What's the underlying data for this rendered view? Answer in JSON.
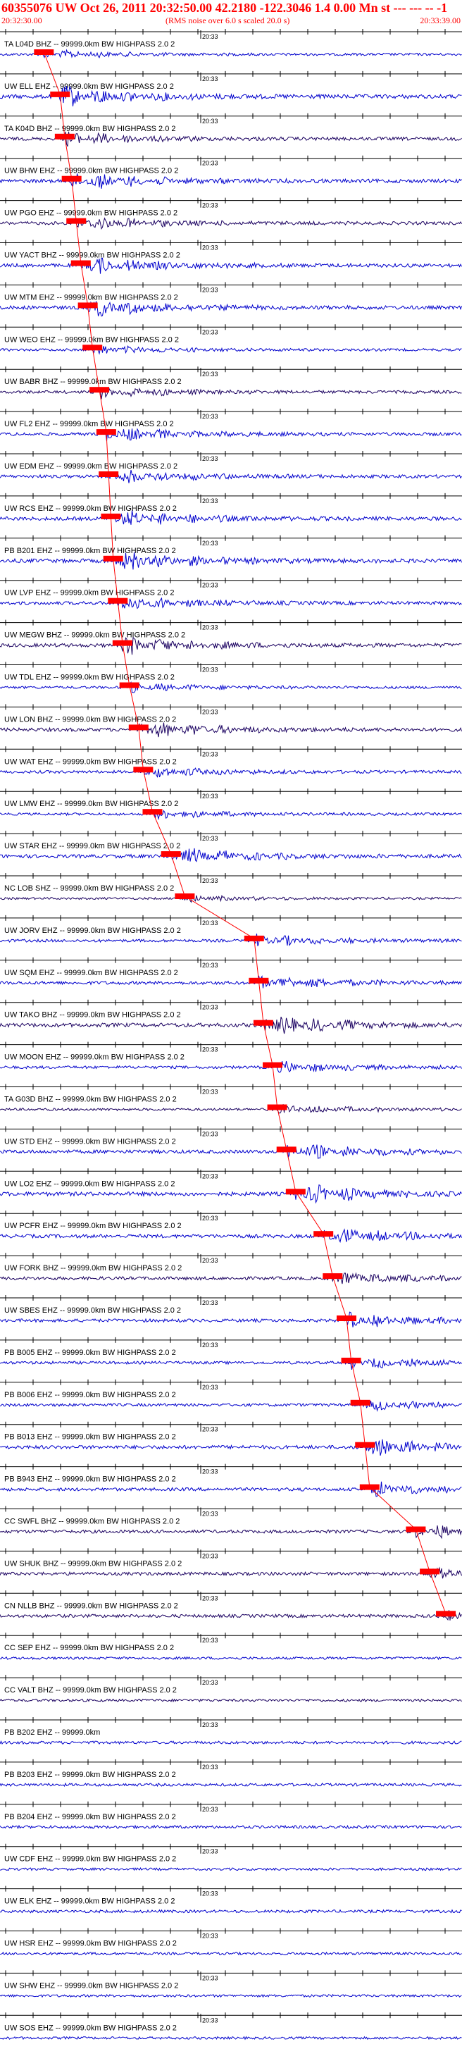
{
  "header": {
    "title": "60355076 UW Oct 26, 2011 20:32:50.00   42.2180 -122.3046  1.4 0.00 Mn st --- --- -- -1",
    "start_time": "20:32:30.00",
    "note": "(RMS noise over 6.0 s scaled 20.0 s)",
    "end_time": "20:33:39.00"
  },
  "minute_label": "20:33",
  "colors": {
    "trace_a": "#0000cc",
    "trace_b": "#1a0060",
    "pick": "#ff0000",
    "axis": "#000000"
  },
  "traces": [
    {
      "label": "TA L04D BHZ -- 99999.0km BW  HIGHPASS  2.0  2",
      "pick": 0.095,
      "amp": 0.3,
      "color": "trace_a"
    },
    {
      "label": "UW ELL EHZ -- 99999.0km BW  HIGHPASS  2.0  2",
      "pick": 0.13,
      "amp": 0.7,
      "color": "trace_a"
    },
    {
      "label": "TA K04D BHZ -- 99999.0km BW  HIGHPASS  2.0  2",
      "pick": 0.14,
      "amp": 0.5,
      "color": "trace_b"
    },
    {
      "label": "UW BHW EHZ -- 99999.0km BW  HIGHPASS  2.0  2",
      "pick": 0.155,
      "amp": 0.6,
      "color": "trace_a"
    },
    {
      "label": "UW PGO EHZ -- 99999.0km BW  HIGHPASS  2.0  2",
      "pick": 0.165,
      "amp": 0.5,
      "color": "trace_b"
    },
    {
      "label": "UW YACT BHZ -- 99999.0km BW  HIGHPASS  2.0  2",
      "pick": 0.175,
      "amp": 0.6,
      "color": "trace_a"
    },
    {
      "label": "UW MTM EHZ -- 99999.0km BW  HIGHPASS  2.0  2",
      "pick": 0.19,
      "amp": 0.6,
      "color": "trace_a"
    },
    {
      "label": "UW WEO EHZ -- 99999.0km BW  HIGHPASS  2.0  2",
      "pick": 0.2,
      "amp": 0.3,
      "color": "trace_a"
    },
    {
      "label": "UW BABR BHZ -- 99999.0km BW  HIGHPASS  2.0  2",
      "pick": 0.215,
      "amp": 0.4,
      "color": "trace_b"
    },
    {
      "label": "UW FL2 EHZ -- 99999.0km BW  HIGHPASS  2.0  2",
      "pick": 0.23,
      "amp": 0.5,
      "color": "trace_a"
    },
    {
      "label": "UW EDM EHZ -- 99999.0km BW  HIGHPASS  2.0  2",
      "pick": 0.235,
      "amp": 0.5,
      "color": "trace_a"
    },
    {
      "label": "UW RCS EHZ -- 99999.0km BW  HIGHPASS  2.0  2",
      "pick": 0.24,
      "amp": 0.6,
      "color": "trace_a"
    },
    {
      "label": "PB B201 EHZ -- 99999.0km BW  HIGHPASS  2.0  2",
      "pick": 0.245,
      "amp": 0.7,
      "color": "trace_a"
    },
    {
      "label": "UW LVP EHZ -- 99999.0km BW  HIGHPASS  2.0  2",
      "pick": 0.255,
      "amp": 0.5,
      "color": "trace_a"
    },
    {
      "label": "UW MEGW BHZ -- 99999.0km BW  HIGHPASS  2.0  2",
      "pick": 0.265,
      "amp": 0.6,
      "color": "trace_b"
    },
    {
      "label": "UW TDL EHZ -- 99999.0km BW  HIGHPASS  2.0  2",
      "pick": 0.28,
      "amp": 0.3,
      "color": "trace_a"
    },
    {
      "label": "UW LON BHZ -- 99999.0km BW  HIGHPASS  2.0  2",
      "pick": 0.3,
      "amp": 0.6,
      "color": "trace_b"
    },
    {
      "label": "UW WAT EHZ -- 99999.0km BW  HIGHPASS  2.0  2",
      "pick": 0.31,
      "amp": 0.4,
      "color": "trace_a"
    },
    {
      "label": "UW LMW EHZ -- 99999.0km BW  HIGHPASS  2.0  2",
      "pick": 0.33,
      "amp": 0.3,
      "color": "trace_a"
    },
    {
      "label": "UW STAR EHZ -- 99999.0km BW  HIGHPASS  2.0  2",
      "pick": 0.37,
      "amp": 0.6,
      "color": "trace_a"
    },
    {
      "label": "NC LOB SHZ -- 99999.0km BW  HIGHPASS  2.0  2",
      "pick": 0.4,
      "amp": 0.2,
      "color": "trace_b"
    },
    {
      "label": "UW JORV EHZ -- 99999.0km BW  HIGHPASS  2.0  2",
      "pick": 0.55,
      "amp": 0.4,
      "color": "trace_a"
    },
    {
      "label": "UW SQM EHZ -- 99999.0km BW  HIGHPASS  2.0  2",
      "pick": 0.56,
      "amp": 0.5,
      "color": "trace_a"
    },
    {
      "label": "UW TAKO BHZ -- 99999.0km BW  HIGHPASS  2.0  2",
      "pick": 0.57,
      "amp": 0.7,
      "color": "trace_b"
    },
    {
      "label": "UW MOON EHZ -- 99999.0km BW  HIGHPASS  2.0  2",
      "pick": 0.59,
      "amp": 0.4,
      "color": "trace_a"
    },
    {
      "label": "TA G03D BHZ -- 99999.0km BW  HIGHPASS  2.0  2",
      "pick": 0.6,
      "amp": 0.3,
      "color": "trace_b"
    },
    {
      "label": "UW STD EHZ -- 99999.0km BW  HIGHPASS  2.0  2",
      "pick": 0.62,
      "amp": 0.6,
      "color": "trace_a"
    },
    {
      "label": "UW LO2 EHZ -- 99999.0km BW  HIGHPASS  2.0  2",
      "pick": 0.64,
      "amp": 0.7,
      "color": "trace_a"
    },
    {
      "label": "UW PCFR EHZ -- 99999.0km BW  HIGHPASS  2.0  2",
      "pick": 0.7,
      "amp": 0.6,
      "color": "trace_a"
    },
    {
      "label": "UW FORK BHZ -- 99999.0km BW  HIGHPASS  2.0  2",
      "pick": 0.72,
      "amp": 0.5,
      "color": "trace_b"
    },
    {
      "label": "UW SBES EHZ -- 99999.0km BW  HIGHPASS  2.0  2",
      "pick": 0.75,
      "amp": 0.5,
      "color": "trace_a"
    },
    {
      "label": "PB B005 EHZ -- 99999.0km BW  HIGHPASS  2.0  2",
      "pick": 0.76,
      "amp": 0.4,
      "color": "trace_a"
    },
    {
      "label": "PB B006 EHZ -- 99999.0km BW  HIGHPASS  2.0  2",
      "pick": 0.78,
      "amp": 0.4,
      "color": "trace_a"
    },
    {
      "label": "PB B013 EHZ -- 99999.0km BW  HIGHPASS  2.0  2",
      "pick": 0.79,
      "amp": 0.6,
      "color": "trace_a"
    },
    {
      "label": "PB B943 EHZ -- 99999.0km BW  HIGHPASS  2.0  2",
      "pick": 0.8,
      "amp": 0.5,
      "color": "trace_a"
    },
    {
      "label": "CC SWFL BHZ -- 99999.0km BW  HIGHPASS  2.0  2",
      "pick": 0.9,
      "amp": 0.5,
      "color": "trace_b"
    },
    {
      "label": "UW SHUK BHZ -- 99999.0km BW  HIGHPASS  2.0  2",
      "pick": 0.93,
      "amp": 0.5,
      "color": "trace_b"
    },
    {
      "label": "CN NLLB BHZ -- 99999.0km BW  HIGHPASS  2.0  2",
      "pick": 0.965,
      "amp": 0.5,
      "color": "trace_b"
    },
    {
      "label": "CC SEP EHZ -- 99999.0km BW  HIGHPASS  2.0  2",
      "pick": null,
      "amp": 0.3,
      "color": "trace_a"
    },
    {
      "label": "CC VALT BHZ -- 99999.0km BW  HIGHPASS  2.0  2",
      "pick": null,
      "amp": 0.3,
      "color": "trace_b"
    },
    {
      "label": "PB B202 EHZ -- 99999.0km",
      "pick": null,
      "amp": 0.4,
      "color": "trace_a"
    },
    {
      "label": "PB B203 EHZ -- 99999.0km BW  HIGHPASS  2.0  2",
      "pick": null,
      "amp": 0.4,
      "color": "trace_a"
    },
    {
      "label": "PB B204 EHZ -- 99999.0km BW  HIGHPASS  2.0  2",
      "pick": null,
      "amp": 0.4,
      "color": "trace_a"
    },
    {
      "label": "UW CDF EHZ -- 99999.0km BW  HIGHPASS  2.0  2",
      "pick": null,
      "amp": 0.3,
      "color": "trace_a"
    },
    {
      "label": "UW ELK EHZ -- 99999.0km BW  HIGHPASS  2.0  2",
      "pick": null,
      "amp": 0.4,
      "color": "trace_a"
    },
    {
      "label": "UW HSR EHZ -- 99999.0km BW  HIGHPASS  2.0  2",
      "pick": null,
      "amp": 0.3,
      "color": "trace_a"
    },
    {
      "label": "UW SHW EHZ -- 99999.0km BW  HIGHPASS  2.0  2",
      "pick": null,
      "amp": 0.3,
      "color": "trace_a"
    },
    {
      "label": "UW SOS EHZ -- 99999.0km BW  HIGHPASS  2.0  2",
      "pick": null,
      "amp": 0.3,
      "color": "trace_a"
    }
  ]
}
